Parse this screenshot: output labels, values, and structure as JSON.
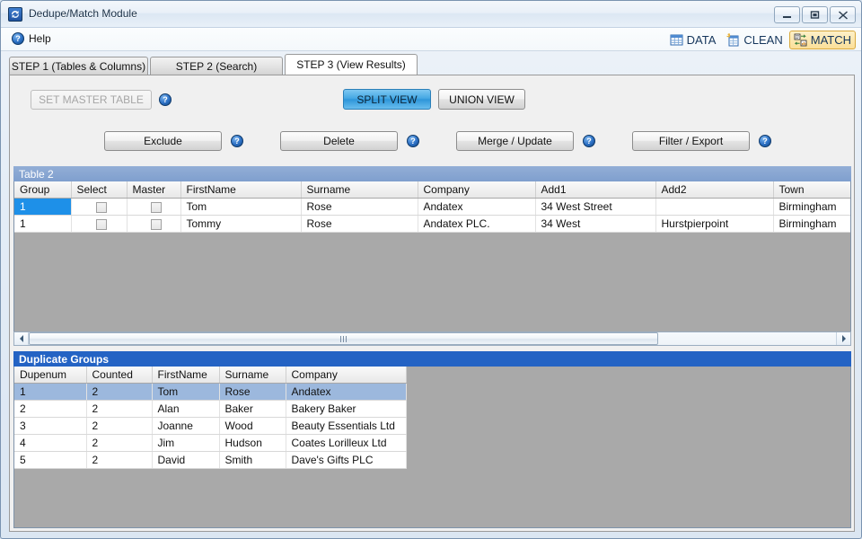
{
  "window": {
    "title": "Dedupe/Match Module",
    "app_icon": "refresh-sync-icon",
    "controls": {
      "minimize": "minimize-icon",
      "maximize": "maximize-icon",
      "close": "close-icon"
    }
  },
  "menubar": {
    "help_label": "Help",
    "help_icon": "help-circle-icon",
    "modes": [
      {
        "label": "DATA",
        "icon": "table-grid-icon",
        "active": false
      },
      {
        "label": "CLEAN",
        "icon": "clean-broom-icon",
        "active": false
      },
      {
        "label": "MATCH",
        "icon": "match-merge-icon",
        "active": true
      }
    ]
  },
  "tabs": [
    {
      "label": "STEP 1  (Tables & Columns)",
      "active": false
    },
    {
      "label": "STEP 2  (Search)",
      "active": false
    },
    {
      "label": "STEP 3 (View Results)",
      "active": true
    }
  ],
  "toolbar": {
    "set_master_table": "SET MASTER TABLE",
    "set_master_table_enabled": false,
    "split_view": "SPLIT VIEW",
    "union_view": "UNION VIEW",
    "active_view": "SPLIT VIEW"
  },
  "actions": [
    {
      "label": "Exclude"
    },
    {
      "label": "Delete"
    },
    {
      "label": "Merge / Update"
    },
    {
      "label": "Filter / Export"
    }
  ],
  "table2": {
    "title": "Table 2",
    "columns": [
      "Group",
      "Select",
      "Master",
      "FirstName",
      "Surname",
      "Company",
      "Add1",
      "Add2",
      "Town"
    ],
    "rows": [
      {
        "selected_cell": true,
        "cells": [
          "1",
          "",
          "",
          "Tom",
          "Rose",
          "Andatex",
          "34 West Street",
          "",
          "Birmingham"
        ]
      },
      {
        "selected_cell": false,
        "cells": [
          "1",
          "",
          "",
          "Tommy",
          "Rose",
          "Andatex PLC.",
          "34 West",
          "Hurstpierpoint",
          "Birmingham"
        ]
      }
    ]
  },
  "duplicate_groups": {
    "title": "Duplicate Groups",
    "columns": [
      "Dupenum",
      "Counted",
      "FirstName",
      "Surname",
      "Company"
    ],
    "rows": [
      {
        "selected": true,
        "cells": [
          "1",
          "2",
          "Tom",
          "Rose",
          "Andatex"
        ]
      },
      {
        "selected": false,
        "cells": [
          "2",
          "2",
          "Alan",
          "Baker",
          "Bakery Baker"
        ]
      },
      {
        "selected": false,
        "cells": [
          "3",
          "2",
          "Joanne",
          "Wood",
          "Beauty Essentials Ltd"
        ]
      },
      {
        "selected": false,
        "cells": [
          "4",
          "2",
          "Jim",
          "Hudson",
          "Coates Lorilleux Ltd"
        ]
      },
      {
        "selected": false,
        "cells": [
          "5",
          "2",
          "David",
          "Smith",
          "Dave's Gifts PLC"
        ]
      }
    ]
  },
  "scrollbar": {
    "left_arrow": "chevron-left-icon",
    "right_arrow": "chevron-right-icon",
    "thumb_grip": "grip-icon"
  },
  "colors": {
    "accent_blue": "#2463c4",
    "table_header_blue": "#7f9fce",
    "selected_cell": "#1e90e8",
    "selected_row": "#9cb8dd",
    "match_highlight": "#fbdf98",
    "primary_button": "#2e96da"
  }
}
